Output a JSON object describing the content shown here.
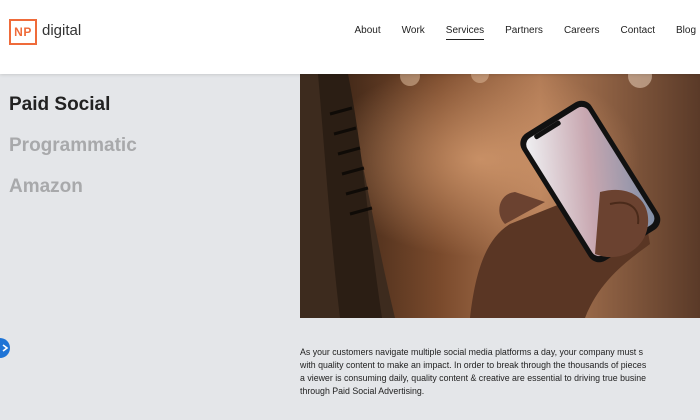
{
  "header": {
    "logo_mark": "NP",
    "logo_word": "digital",
    "nav": [
      "About",
      "Work",
      "Services",
      "Partners",
      "Careers",
      "Contact",
      "Blog"
    ],
    "active_nav": "Services"
  },
  "sidebar": {
    "items": [
      {
        "label": "Paid Social",
        "active": true
      },
      {
        "label": "Programmatic",
        "active": false
      },
      {
        "label": "Amazon",
        "active": false
      }
    ]
  },
  "content": {
    "paragraph_lines": [
      "As your customers navigate multiple social media platforms a day, your company must s",
      "with quality content to make an impact. In order to break through the thousands of pieces",
      "a viewer is consuming daily, quality content & creative are essential to driving true busine",
      "through Paid Social Advertising."
    ]
  },
  "colors": {
    "accent": "#ef6b3a",
    "background": "#e4e6e9",
    "active_text": "#222222",
    "inactive_text": "#a8a9ab",
    "fab": "#1e74d6"
  }
}
